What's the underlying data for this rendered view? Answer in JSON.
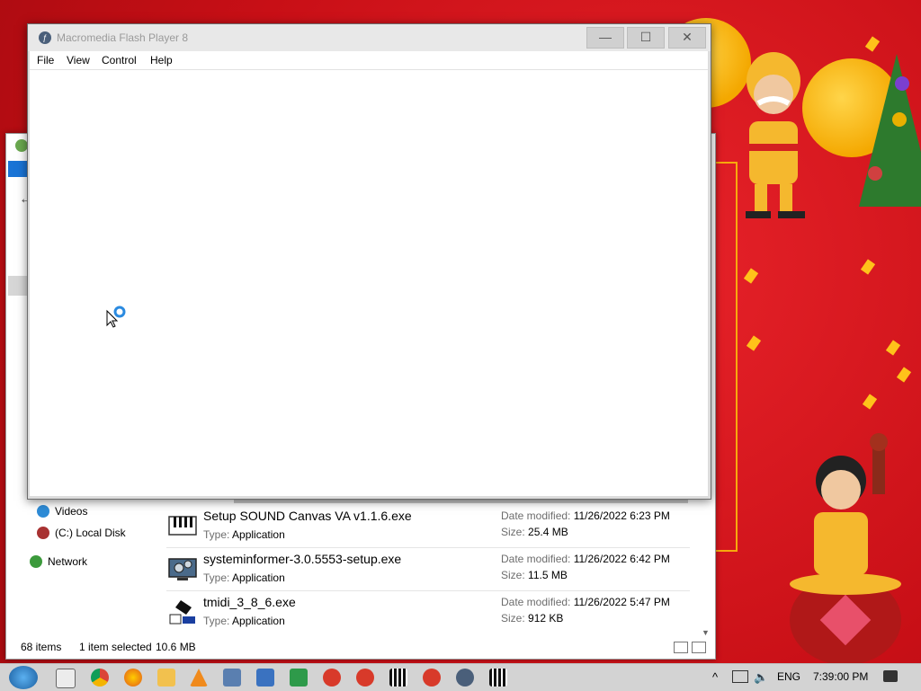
{
  "flash_window": {
    "title": "Macromedia Flash Player 8",
    "menu": [
      "File",
      "View",
      "Control",
      "Help"
    ],
    "minimize_symbol": "—",
    "maximize_symbol": "☐",
    "close_symbol": "✕"
  },
  "explorer": {
    "nav": [
      "Videos",
      "(C:) Local Disk",
      "Network"
    ],
    "files": [
      {
        "name": "Setup SOUND Canvas VA v1.1.6.exe",
        "type_label": "Type:",
        "type": "Application",
        "date_label": "Date modified:",
        "date": "11/26/2022 6:23 PM",
        "size_label": "Size:",
        "size": "25.4 MB",
        "icon": "piano-icon"
      },
      {
        "name": "systeminformer-3.0.5553-setup.exe",
        "type_label": "Type:",
        "type": "Application",
        "date_label": "Date modified:",
        "date": "11/26/2022 6:42 PM",
        "size_label": "Size:",
        "size": "11.5 MB",
        "icon": "monitor-gear-icon"
      },
      {
        "name": "tmidi_3_8_6.exe",
        "type_label": "Type:",
        "type": "Application",
        "date_label": "Date modified:",
        "date": "11/26/2022 5:47 PM",
        "size_label": "Size:",
        "size": "912 KB",
        "icon": "midi-icon"
      }
    ],
    "status": {
      "items": "68 items",
      "selected": "1 item selected",
      "size": "10.6 MB"
    }
  },
  "taskbar": {
    "language": "ENG",
    "time": "7:39:00 PM"
  },
  "colors": {
    "desktop_red": "#d8141c",
    "taskbar": "#d3d3d3",
    "accent_blue": "#1a74d6"
  }
}
